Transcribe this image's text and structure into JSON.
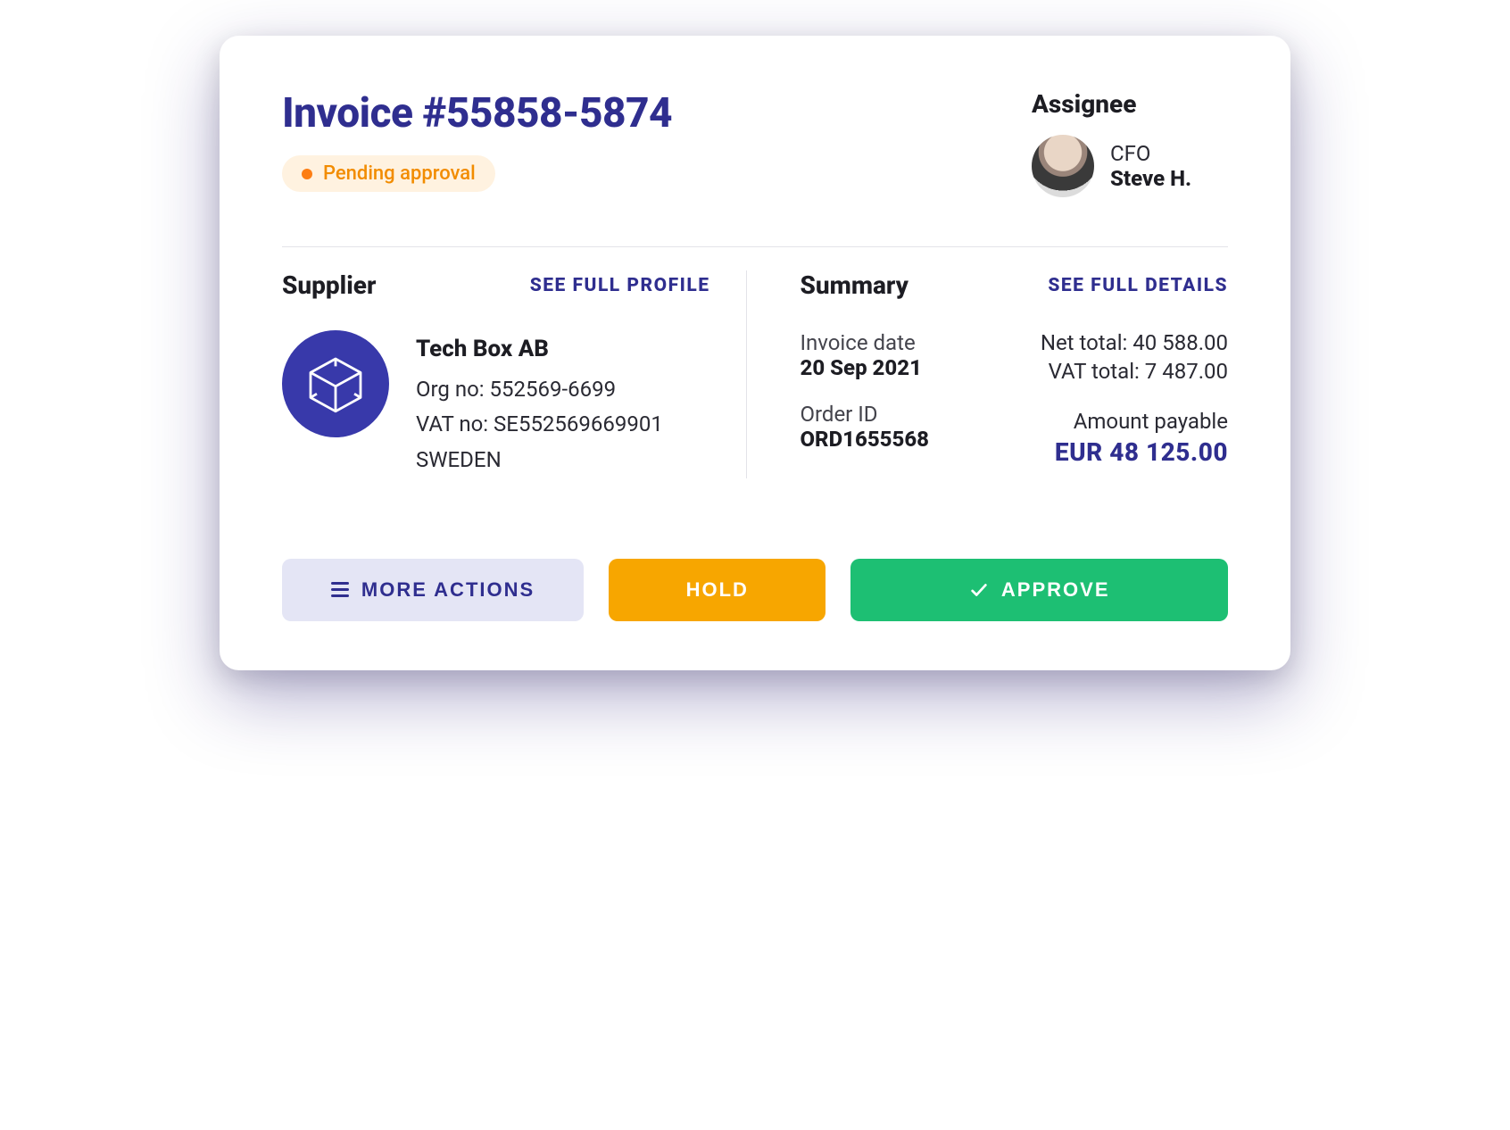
{
  "header": {
    "title": "Invoice #55858-5874",
    "status_label": "Pending approval"
  },
  "assignee": {
    "heading": "Assignee",
    "role": "CFO",
    "name": "Steve H."
  },
  "supplier": {
    "heading": "Supplier",
    "link": "SEE FULL PROFILE",
    "name": "Tech Box AB",
    "org_line": "Org no: 552569-6699",
    "vat_line": "VAT no: SE552569669901",
    "country": "SWEDEN"
  },
  "summary": {
    "heading": "Summary",
    "link": "SEE FULL DETAILS",
    "invoice_date_label": "Invoice date",
    "invoice_date_value": "20 Sep 2021",
    "order_id_label": "Order ID",
    "order_id_value": "ORD1655568",
    "net_total_line": "Net total: 40 588.00",
    "vat_total_line": "VAT total: 7 487.00",
    "amount_payable_label": "Amount payable",
    "amount_payable_value": "EUR  48 125.00"
  },
  "actions": {
    "more": "MORE ACTIONS",
    "hold": "HOLD",
    "approve": "APPROVE"
  }
}
